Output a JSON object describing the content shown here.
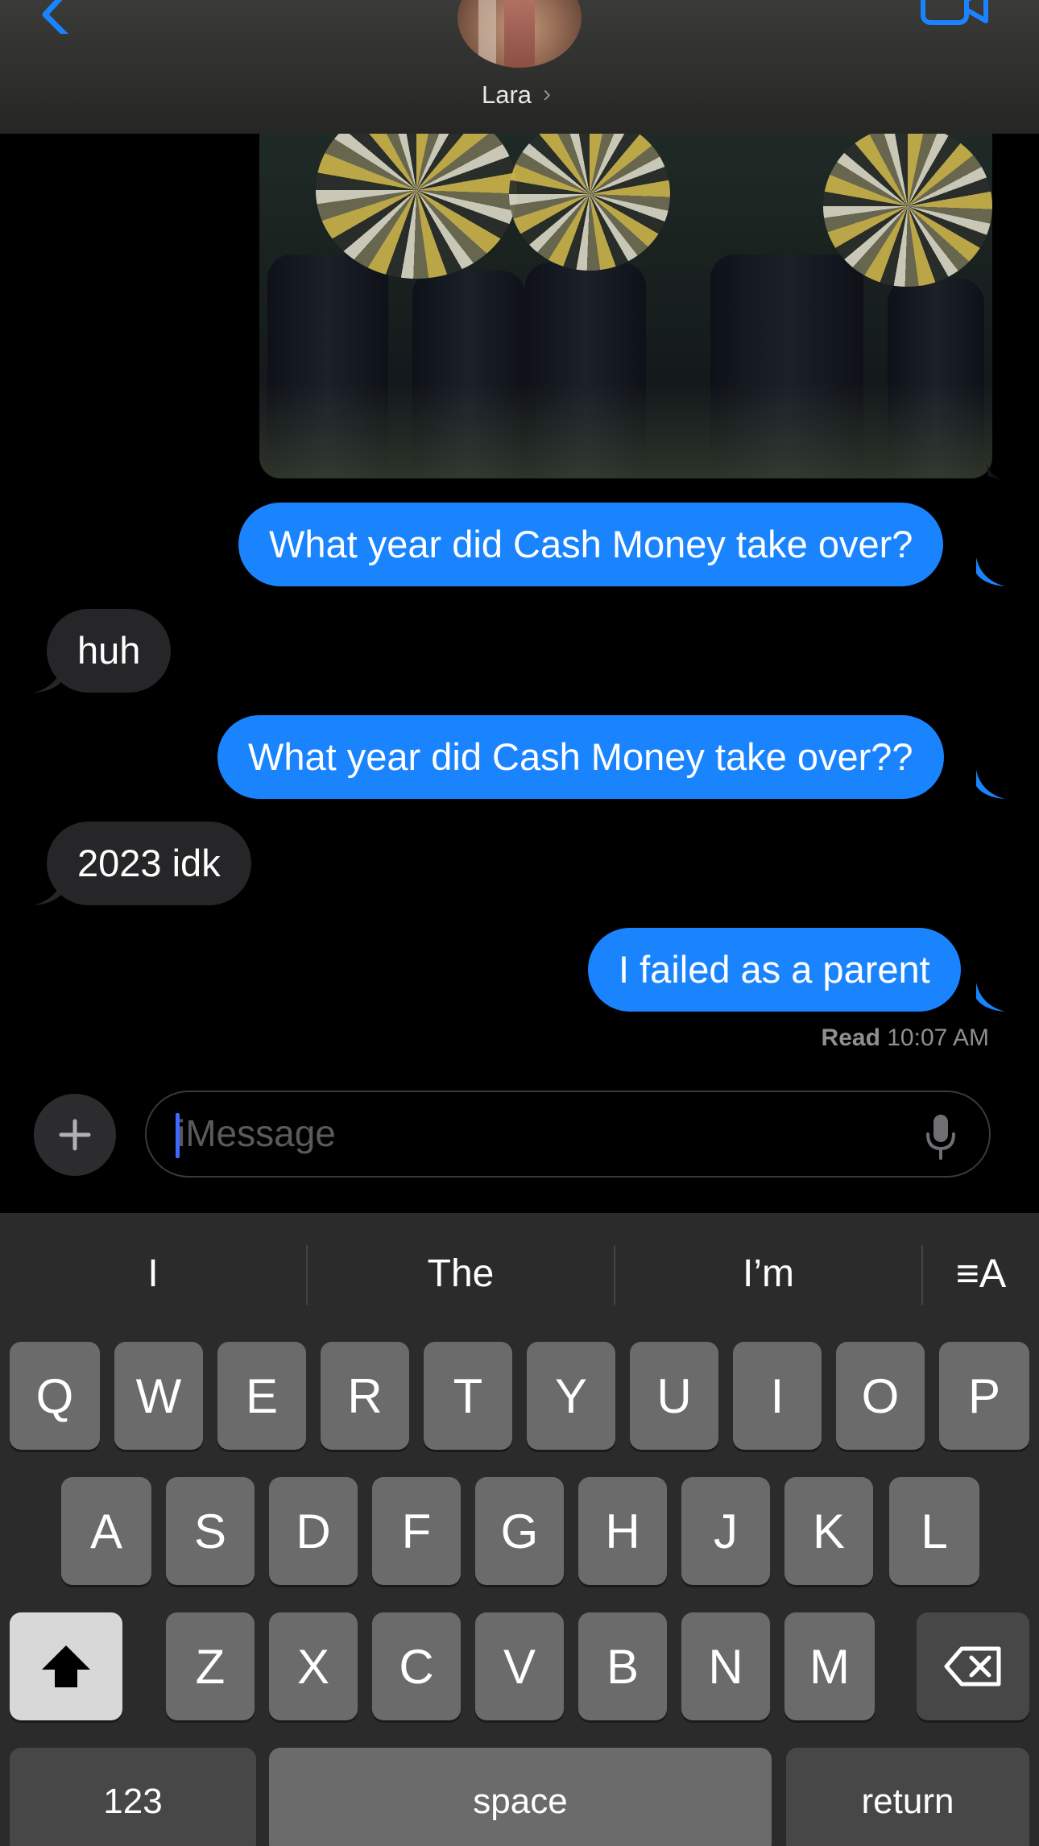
{
  "header": {
    "contact_name": "Lara",
    "chevron": "›",
    "back_icon": "chevron-left-icon",
    "video_icon": "video-camera-icon",
    "accent": "#1a84ff"
  },
  "messages": [
    {
      "side": "sent",
      "text": "What year did Cash Money take over?"
    },
    {
      "side": "received",
      "text": "huh"
    },
    {
      "side": "sent",
      "text": "What year did Cash Money take over??"
    },
    {
      "side": "received",
      "text": "2023 idk"
    },
    {
      "side": "sent",
      "text": "I failed as a parent"
    }
  ],
  "receipt": {
    "label": "Read",
    "time": "10:07 AM"
  },
  "composer": {
    "placeholder": "iMessage",
    "plus_icon": "plus-icon",
    "mic_icon": "microphone-icon"
  },
  "keyboard": {
    "suggestions": [
      "I",
      "The",
      "I’m"
    ],
    "format_icon": "text-format-icon",
    "format_label": "≡A",
    "row1": [
      "Q",
      "W",
      "E",
      "R",
      "T",
      "Y",
      "U",
      "I",
      "O",
      "P"
    ],
    "row2": [
      "A",
      "S",
      "D",
      "F",
      "G",
      "H",
      "J",
      "K",
      "L"
    ],
    "row3": [
      "Z",
      "X",
      "C",
      "V",
      "B",
      "N",
      "M"
    ],
    "numbers_label": "123",
    "space_label": "space",
    "return_label": "return",
    "shift_icon": "shift-icon",
    "delete_icon": "delete-backspace-icon"
  }
}
